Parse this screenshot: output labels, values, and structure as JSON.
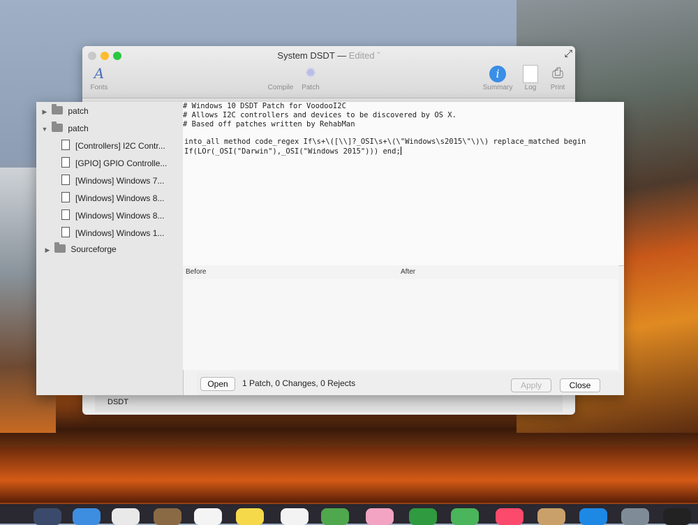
{
  "window": {
    "title": "System DSDT —",
    "edited": "Edited ˇ",
    "toolbar": [
      {
        "label": "Fonts",
        "icon": "fonts-icon"
      },
      {
        "label": "Compile",
        "icon": "compile-icon"
      },
      {
        "label": "Patch",
        "icon": "patch-icon"
      },
      {
        "label": "Summary",
        "icon": "summary-icon"
      },
      {
        "label": "Log",
        "icon": "log-icon"
      },
      {
        "label": "Print",
        "icon": "print-icon"
      }
    ],
    "bottom_label": "DSDT",
    "colors": {
      "close": "#fd5f57",
      "minimize": "#febc2e",
      "zoom": "#29c840",
      "summary_blue": "#3a8ee6"
    }
  },
  "sidebar": {
    "items": [
      {
        "label": "patch"
      },
      {
        "label": "patch"
      },
      {
        "label": "[Controllers] I2C Contr..."
      },
      {
        "label": "[GPIO] GPIO Controlle..."
      },
      {
        "label": "[Windows] Windows 7..."
      },
      {
        "label": "[Windows] Windows 8..."
      },
      {
        "label": "[Windows] Windows 8..."
      },
      {
        "label": "[Windows] Windows 1..."
      },
      {
        "label": "Sourceforge"
      }
    ]
  },
  "editor": {
    "lines": [
      "# Windows 10 DSDT Patch for VoodooI2C",
      "# Allows I2C controllers and devices to be discovered by OS X.",
      "# Based off patches written by RehabMan",
      "",
      "into_all method code_regex If\\s+\\([\\\\]?_OSI\\s+\\(\\\"Windows\\s2015\\\"\\)\\) replace_matched begin",
      "If(LOr(_OSI(\"Darwin\"),_OSI(\"Windows 2015\"))) end;"
    ]
  },
  "compare": {
    "before_label": "Before",
    "after_label": "After"
  },
  "footer": {
    "open_label": "Open",
    "status": "1 Patch, 0 Changes, 0 Rejects",
    "apply_label": "Apply",
    "close_label": "Close"
  }
}
